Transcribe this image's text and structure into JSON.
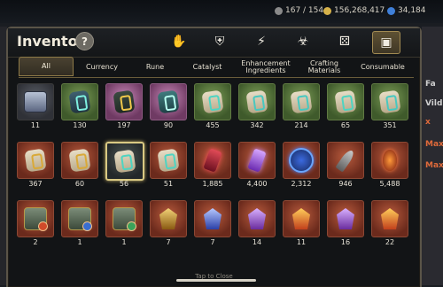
{
  "topbar": {
    "energy": "167 / 154",
    "silver": "156,268,417",
    "gems": "34,184"
  },
  "side": {
    "right_labels": [
      "Fa",
      "Vildri",
      "x",
      "Max",
      "Max"
    ]
  },
  "inventory": {
    "title": "Inventory",
    "help": "?",
    "category_icons": [
      {
        "name": "gauntlet-icon",
        "glyph": "✋"
      },
      {
        "name": "shield-icon",
        "glyph": "⛨"
      },
      {
        "name": "lightning-icon",
        "glyph": "⚡"
      },
      {
        "name": "monster-icon",
        "glyph": "☣"
      },
      {
        "name": "dice-icon",
        "glyph": "⚄"
      },
      {
        "name": "chest-icon",
        "glyph": "▣"
      }
    ],
    "tabs": [
      "All",
      "Currency",
      "Rune",
      "Catalyst",
      "Enhancement Ingredients",
      "Crafting Materials",
      "Consumable"
    ],
    "active_tab": "All",
    "items": [
      [
        "11",
        "130",
        "197",
        "90",
        "455",
        "342",
        "214",
        "65",
        "351"
      ],
      [
        "367",
        "60",
        "56",
        "51",
        "1,885",
        "4,400",
        "2,312",
        "946",
        "5,488"
      ],
      [
        "2",
        "1",
        "1",
        "7",
        "7",
        "14",
        "11",
        "16",
        "22"
      ]
    ],
    "footer": "Tap to Close"
  }
}
